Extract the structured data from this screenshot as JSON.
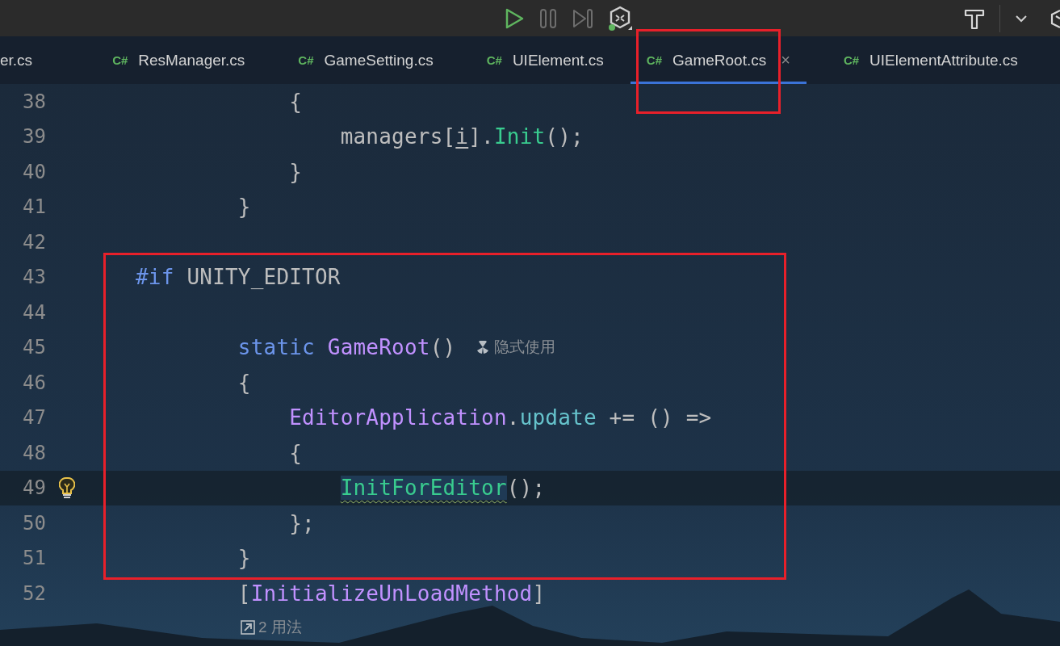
{
  "toolbar": {
    "buttons": [
      {
        "kind": "play",
        "disabled": false
      },
      {
        "kind": "pause",
        "disabled": true
      },
      {
        "kind": "step",
        "disabled": true
      },
      {
        "kind": "unity",
        "disabled": false
      }
    ],
    "right_buttons": [
      {
        "kind": "hammer"
      },
      {
        "kind": "chevron"
      },
      {
        "kind": "partial"
      }
    ]
  },
  "tabs": [
    {
      "label": "er.cs",
      "selected": false,
      "boxed": false
    },
    {
      "label": "ResManager.cs",
      "icon": "C#",
      "selected": false,
      "boxed": false
    },
    {
      "label": "GameSetting.cs",
      "icon": "C#",
      "selected": false,
      "boxed": false
    },
    {
      "label": "UIElement.cs",
      "icon": "C#",
      "selected": false,
      "boxed": false
    },
    {
      "label": "GameRoot.cs",
      "icon": "C#",
      "selected": true,
      "boxed": true,
      "close": "×"
    },
    {
      "label": "UIElementAttribute.cs",
      "icon": "C#",
      "selected": false,
      "boxed": false
    }
  ],
  "lines": [
    {
      "kind": "line",
      "number": "38",
      "tokens": [
        {
          "kind": "plain",
          "text": "            {"
        }
      ]
    },
    {
      "kind": "line",
      "number": "39",
      "tokens": [
        {
          "kind": "plain",
          "text": "                managers["
        },
        {
          "kind": "local",
          "text": "i"
        },
        {
          "kind": "plain",
          "text": "]."
        },
        {
          "kind": "method",
          "text": "Init"
        },
        {
          "kind": "plain",
          "text": "();"
        }
      ]
    },
    {
      "kind": "line",
      "number": "40",
      "tokens": [
        {
          "kind": "plain",
          "text": "            }"
        }
      ]
    },
    {
      "kind": "line",
      "number": "41",
      "tokens": [
        {
          "kind": "plain",
          "text": "        }"
        }
      ]
    },
    {
      "kind": "line",
      "number": "42"
    },
    {
      "kind": "annotation",
      "lines": [
        {
          "kind": "line",
          "number": "43",
          "tokens": [
            {
              "kind": "keyword",
              "text": "#if"
            },
            {
              "kind": "plain",
              "text": " UNITY_EDITOR"
            }
          ]
        },
        {
          "kind": "line",
          "number": "44"
        },
        {
          "kind": "line",
          "number": "45",
          "tokens": [
            {
              "kind": "keyword",
              "text": "        static"
            },
            {
              "kind": "type",
              "text": " GameRoot"
            },
            {
              "kind": "plain",
              "text": "()"
            }
          ],
          "hint": "隐式使用"
        },
        {
          "kind": "line",
          "number": "46",
          "tokens": [
            {
              "kind": "plain",
              "text": "        {"
            }
          ]
        },
        {
          "kind": "line",
          "number": "47",
          "tokens": [
            {
              "kind": "type",
              "text": "            EditorApplication."
            },
            {
              "kind": "field",
              "text": "update"
            },
            {
              "kind": "plain",
              "text": " += () =>"
            }
          ]
        },
        {
          "kind": "line",
          "number": "48",
          "tokens": [
            {
              "kind": "plain",
              "text": "            {"
            }
          ]
        },
        {
          "kind": "line",
          "number": "49",
          "current": true,
          "bulb": true,
          "tokens": [
            {
              "kind": "warning",
              "text": "                InitForEditor"
            },
            {
              "kind": "plain",
              "text": "();"
            }
          ]
        },
        {
          "kind": "line",
          "number": "50",
          "tokens": [
            {
              "kind": "plain",
              "text": "            };"
            }
          ]
        },
        {
          "kind": "line",
          "number": "51",
          "tokens": [
            {
              "kind": "plain",
              "text": "        }"
            }
          ]
        }
      ]
    },
    {
      "kind": "line",
      "number": "52",
      "tokens": [
        {
          "kind": "plain",
          "text": "        ["
        },
        {
          "kind": "type",
          "text": "InitializeUnLoadMethod"
        },
        {
          "kind": "plain",
          "text": "]"
        }
      ]
    }
  ],
  "usages": "2 用法"
}
